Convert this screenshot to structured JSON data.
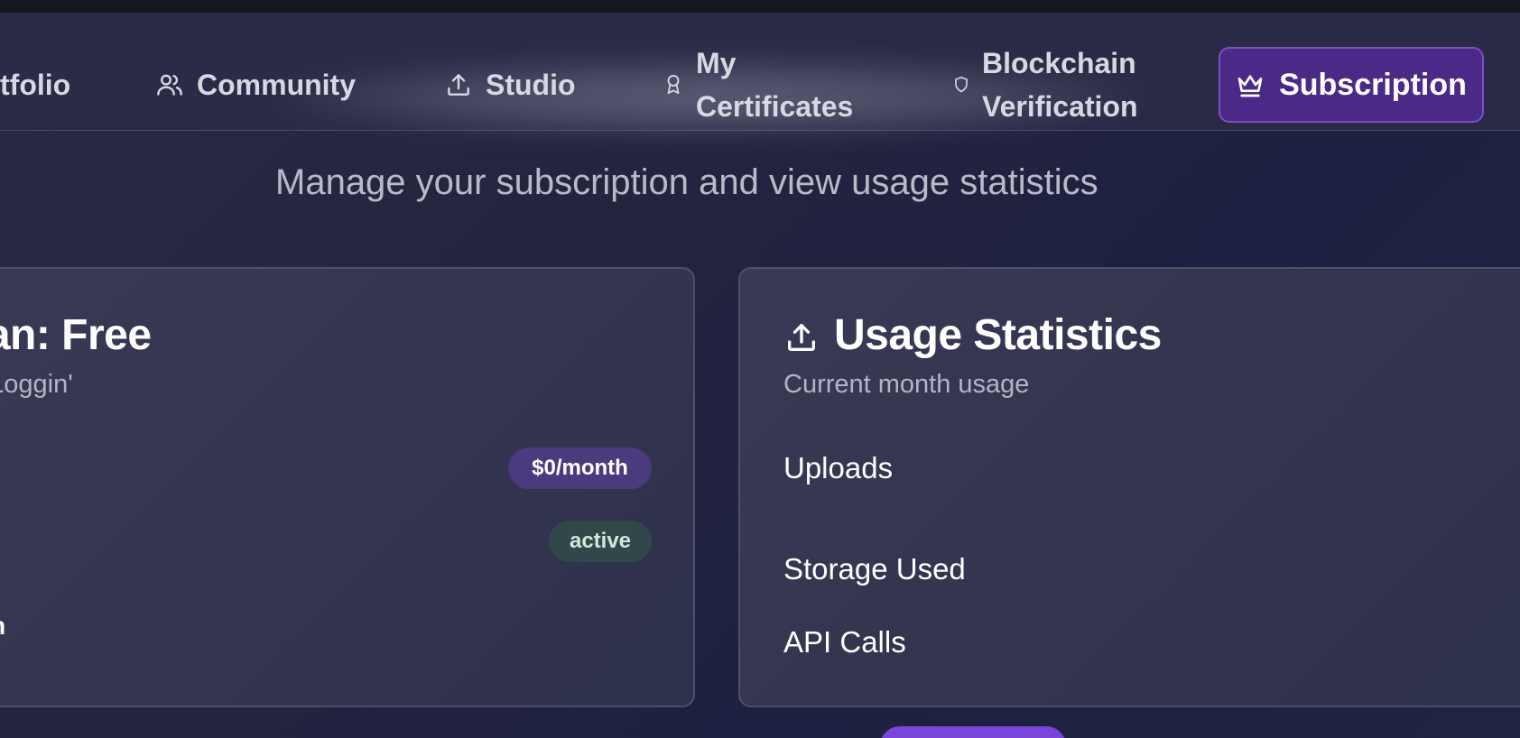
{
  "nav": {
    "portfolio_label": "tfolio",
    "community_label": "Community",
    "studio_label": "Studio",
    "certificates_line1": "My",
    "certificates_line2": "Certificates",
    "blockchain_line1": "Blockchain",
    "blockchain_line2": "Verification",
    "subscription_label": "Subscription"
  },
  "page": {
    "subtitle": "Manage your subscription and view usage statistics"
  },
  "plan_card": {
    "title": "lan: Free",
    "subtitle": "t Loggin'",
    "price_badge": "$0/month",
    "status_badge": "active",
    "row_label": "on"
  },
  "usage_card": {
    "title": "Usage Statistics",
    "subtitle": "Current month usage",
    "rows": [
      "Uploads",
      "Storage Used",
      "API Calls"
    ]
  },
  "colors": {
    "accent_purple": "#4a2a86",
    "price_badge_bg": "#4b3a7e",
    "status_badge_bg": "#30484a",
    "status_badge_text": "#cfe8dc"
  }
}
